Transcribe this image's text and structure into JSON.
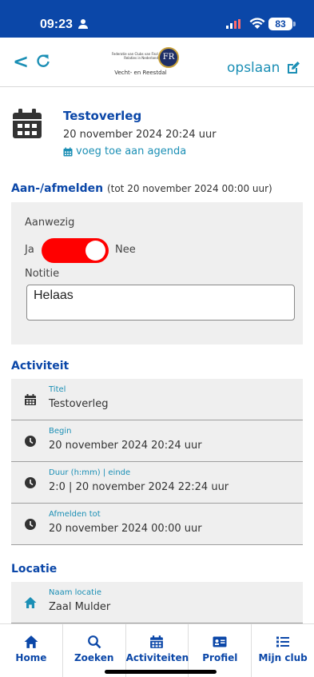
{
  "status_bar": {
    "time": "09:23",
    "battery": "83"
  },
  "header": {
    "back_label": "<",
    "logo_small_text": "Federatie van Clubs van Fiscl Relaties in Nederland",
    "logo_monogram": "FR",
    "logo_name": "Vecht- en Reestdal",
    "save_label": "opslaan"
  },
  "event": {
    "title": "Testoverleg",
    "date": "20 november 2024 20:24 uur",
    "agenda_link": "voeg toe aan agenda"
  },
  "signup": {
    "heading": "Aan-/afmelden",
    "deadline": "(tot 20 november 2024 00:00 uur)",
    "present_label": "Aanwezig",
    "yes_label": "Ja",
    "no_label": "Nee",
    "toggle_state": "Nee",
    "note_label": "Notitie",
    "note_value": "Helaas"
  },
  "activity": {
    "heading": "Activiteit",
    "rows": [
      {
        "icon": "calendar-icon",
        "label": "Titel",
        "value": "Testoverleg"
      },
      {
        "icon": "clock-icon",
        "label": "Begin",
        "value": "20 november 2024 20:24 uur"
      },
      {
        "icon": "clock-icon",
        "label": "Duur (h:mm) | einde",
        "value": "2:0 | 20 november 2024 22:24 uur"
      },
      {
        "icon": "clock-icon",
        "label": "Afmelden tot",
        "value": "20 november 2024 00:00 uur"
      }
    ]
  },
  "location": {
    "heading": "Locatie",
    "rows": [
      {
        "icon": "home-icon",
        "label": "Naam locatie",
        "value": "Zaal Mulder"
      }
    ]
  },
  "tabbar": {
    "tabs": [
      {
        "label": "Home",
        "icon": "home-icon"
      },
      {
        "label": "Zoeken",
        "icon": "search-icon"
      },
      {
        "label": "Activiteiten",
        "icon": "calendar-icon"
      },
      {
        "label": "Profiel",
        "icon": "id-card-icon"
      },
      {
        "label": "Mijn club",
        "icon": "list-icon"
      }
    ]
  },
  "colors": {
    "primary": "#0b47a8",
    "accent": "#1b8fb5",
    "toggle": "#ff0000",
    "panel": "#efefef"
  }
}
